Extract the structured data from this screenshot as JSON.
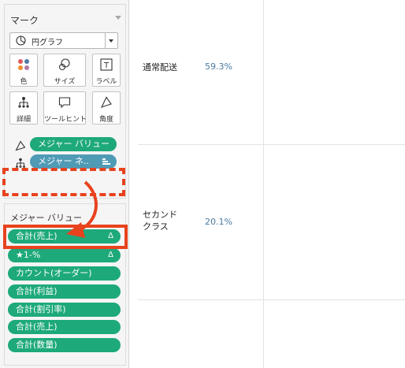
{
  "marks": {
    "title": "マーク",
    "mark_type": "円グラフ",
    "buttons": {
      "color": "色",
      "size": "サイズ",
      "label": "ラベル",
      "detail": "詳細",
      "tooltip": "ツールヒント",
      "angle": "角度"
    },
    "label_button_glyph": "T",
    "shelf": [
      {
        "text": "メジャー バリュー",
        "color": "#1ea97b",
        "icon": "angle-icon"
      },
      {
        "text": "メジャー ネ..",
        "color": "#4f9bb6",
        "icon": "detail-icon"
      }
    ]
  },
  "measure_values": {
    "title": "メジャー バリュー",
    "delta_glyph": "Δ",
    "items": [
      {
        "text": "合計(売上)",
        "has_delta": true
      },
      {
        "text": "★1-%",
        "has_delta": true
      },
      {
        "text": "カウント(オーダー)",
        "has_delta": false
      },
      {
        "text": "合計(利益)",
        "has_delta": false
      },
      {
        "text": "合計(割引率)",
        "has_delta": false
      },
      {
        "text": "合計(売上)",
        "has_delta": false
      },
      {
        "text": "合計(数量)",
        "has_delta": false
      }
    ]
  },
  "view": {
    "rows": [
      {
        "label": "通常配送",
        "value": "59.3%"
      },
      {
        "label": "セカンド\nクラス",
        "value": "20.1%"
      }
    ]
  },
  "colors": {
    "pill_green": "#1ea97b",
    "pill_blue": "#4f9bb6",
    "highlight_red": "#e8421e"
  }
}
